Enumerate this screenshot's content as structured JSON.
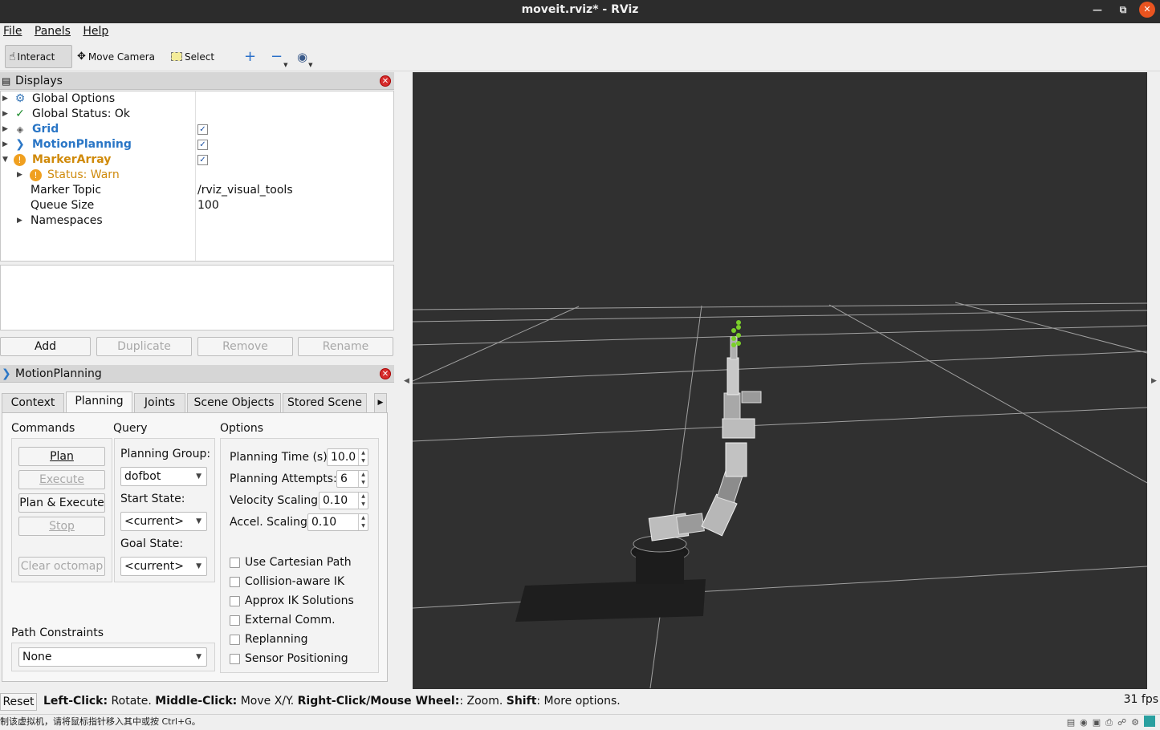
{
  "window": {
    "title": "moveit.rviz* - RViz"
  },
  "menu": [
    {
      "label": "File"
    },
    {
      "label": "Panels"
    },
    {
      "label": "Help"
    }
  ],
  "toolbar": {
    "interact": "Interact",
    "move_camera": "Move Camera",
    "select": "Select"
  },
  "displays": {
    "title": "Displays",
    "rows": [
      {
        "label": "Global Options"
      },
      {
        "label": "Global Status: Ok"
      },
      {
        "label": "Grid",
        "checked": true
      },
      {
        "label": "MotionPlanning",
        "checked": true
      },
      {
        "label": "MarkerArray",
        "checked": true
      },
      {
        "label": "Status: Warn"
      },
      {
        "label": "Marker Topic",
        "value": "/rviz_visual_tools"
      },
      {
        "label": "Queue Size",
        "value": "100"
      },
      {
        "label": "Namespaces"
      }
    ],
    "buttons": {
      "add": "Add",
      "duplicate": "Duplicate",
      "remove": "Remove",
      "rename": "Rename"
    }
  },
  "motion_planning": {
    "title": "MotionPlanning",
    "tabs": [
      "Context",
      "Planning",
      "Joints",
      "Scene Objects",
      "Stored Scene"
    ],
    "selected_tab": "Planning",
    "commands": {
      "label": "Commands",
      "plan": "Plan",
      "execute": "Execute",
      "plan_execute": "Plan & Execute",
      "stop": "Stop",
      "clear_octomap": "Clear octomap"
    },
    "query": {
      "label": "Query",
      "planning_group_label": "Planning Group:",
      "planning_group": "dofbot",
      "start_state_label": "Start State:",
      "start_state": "<current>",
      "goal_state_label": "Goal State:",
      "goal_state": "<current>"
    },
    "options": {
      "label": "Options",
      "planning_time_label": "Planning Time (s):",
      "planning_time": "10.0",
      "planning_attempts_label": "Planning Attempts:",
      "planning_attempts": "6",
      "velocity_scaling_label": "Velocity Scaling:",
      "velocity_scaling": "0.10",
      "accel_scaling_label": "Accel. Scaling:",
      "accel_scaling": "0.10",
      "checks": [
        "Use Cartesian Path",
        "Collision-aware IK",
        "Approx IK Solutions",
        "External Comm.",
        "Replanning",
        "Sensor Positioning"
      ]
    },
    "path_constraints": {
      "label": "Path Constraints",
      "value": "None"
    }
  },
  "status": {
    "reset": "Reset",
    "left_click": "Left-Click:",
    "left_click_text": " Rotate. ",
    "middle_click": "Middle-Click:",
    "middle_click_text": " Move X/Y. ",
    "right_click": "Right-Click/Mouse Wheel:",
    "right_click_text": ": Zoom. ",
    "shift": "Shift",
    "shift_text": ": More options.",
    "fps": "31 fps"
  },
  "vm_bar": {
    "text": "制该虚拟机，请将鼠标指针移入其中或按 Ctrl+G。"
  }
}
